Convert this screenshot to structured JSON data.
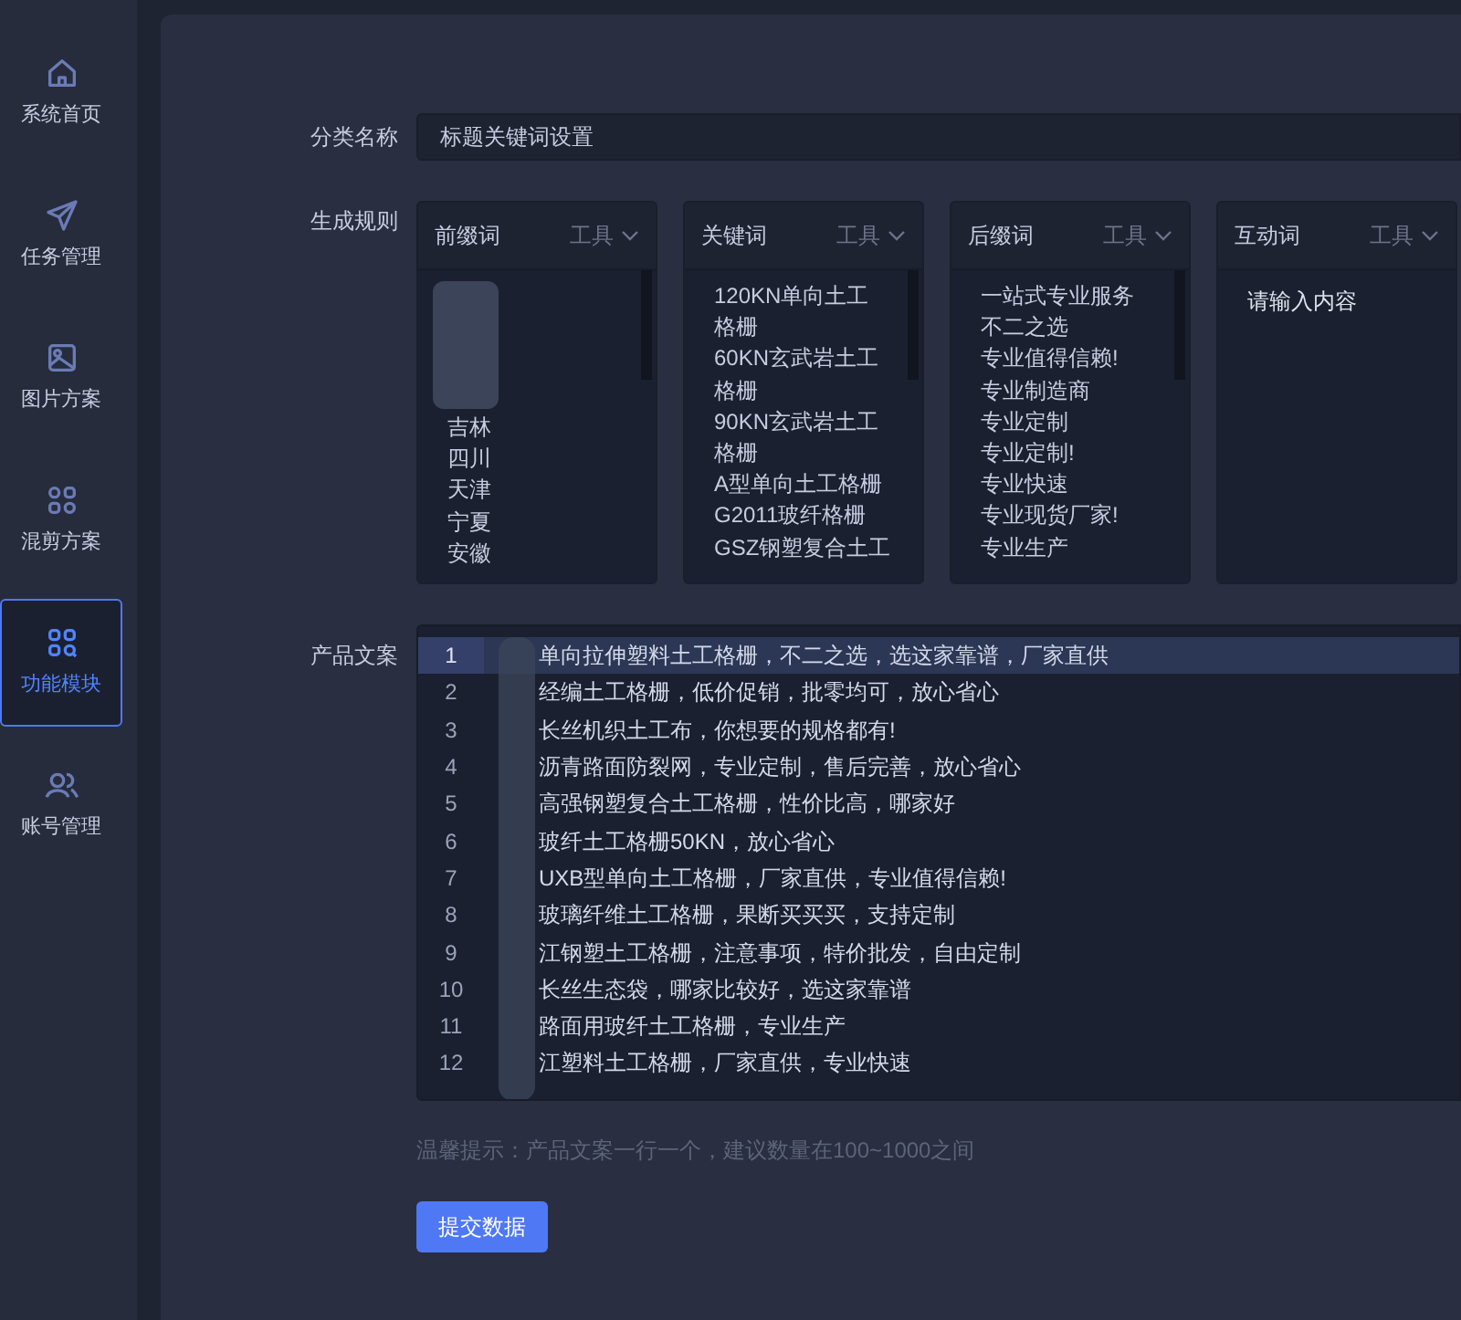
{
  "sidebar": {
    "items": [
      {
        "label": "系统首页",
        "selected": false
      },
      {
        "label": "任务管理",
        "selected": false
      },
      {
        "label": "图片方案",
        "selected": false
      },
      {
        "label": "混剪方案",
        "selected": false
      },
      {
        "label": "功能模块",
        "selected": true
      },
      {
        "label": "账号管理",
        "selected": false
      }
    ]
  },
  "form": {
    "category_label": "分类名称",
    "category_value": "标题关键词设置",
    "rules_label": "生成规则",
    "rules": [
      {
        "title": "前缀词",
        "tool": "工具",
        "redacted": true,
        "lines": [
          "吉林",
          "四川",
          "天津",
          "宁夏",
          "安徽"
        ]
      },
      {
        "title": "关键词",
        "tool": "工具",
        "redacted": false,
        "lines": [
          "120KN单向土工",
          "格栅",
          "60KN玄武岩土工",
          "格栅",
          "90KN玄武岩土工",
          "格栅",
          "A型单向土工格栅",
          "G2011玻纤格栅",
          "GSZ钢塑复合土工"
        ]
      },
      {
        "title": "后缀词",
        "tool": "工具",
        "redacted": false,
        "lines": [
          "一站式专业服务",
          "不二之选",
          "专业值得信赖!",
          "专业制造商",
          "专业定制",
          "专业定制!",
          "专业快速",
          "专业现货厂家!",
          "专业生产"
        ]
      },
      {
        "title": "互动词",
        "tool": "工具",
        "redacted": false,
        "placeholder": "请输入内容"
      }
    ],
    "copy_label": "产品文案",
    "copy_lines": [
      {
        "number": "1",
        "text": "单向拉伸塑料土工格栅，不二之选，选这家靠谱，厂家直供",
        "selected": true
      },
      {
        "number": "2",
        "text": "经编土工格栅，低价促销，批零均可，放心省心",
        "selected": false
      },
      {
        "number": "3",
        "text": "长丝机织土工布，你想要的规格都有!",
        "selected": false
      },
      {
        "number": "4",
        "text": "沥青路面防裂网，专业定制，售后完善，放心省心",
        "selected": false
      },
      {
        "number": "5",
        "text": "高强钢塑复合土工格栅，性价比高，哪家好",
        "selected": false
      },
      {
        "number": "6",
        "text": "玻纤土工格栅50KN，放心省心",
        "selected": false
      },
      {
        "number": "7",
        "text": "UXB型单向土工格栅，厂家直供，专业值得信赖!",
        "selected": false
      },
      {
        "number": "8",
        "text": "玻璃纤维土工格栅，果断买买买，支持定制",
        "selected": false
      },
      {
        "number": "9",
        "text": "江钢塑土工格栅，注意事项，特价批发，自由定制",
        "selected": false
      },
      {
        "number": "10",
        "text": "长丝生态袋，哪家比较好，选这家靠谱",
        "selected": false
      },
      {
        "number": "11",
        "text": "路面用玻纤土工格栅，专业生产",
        "selected": false
      },
      {
        "number": "12",
        "text": "江塑料土工格栅，厂家直供，专业快速",
        "selected": false
      }
    ],
    "hint": "温馨提示：产品文案一行一个，建议数量在100~1000之间",
    "submit": "提交数据"
  }
}
